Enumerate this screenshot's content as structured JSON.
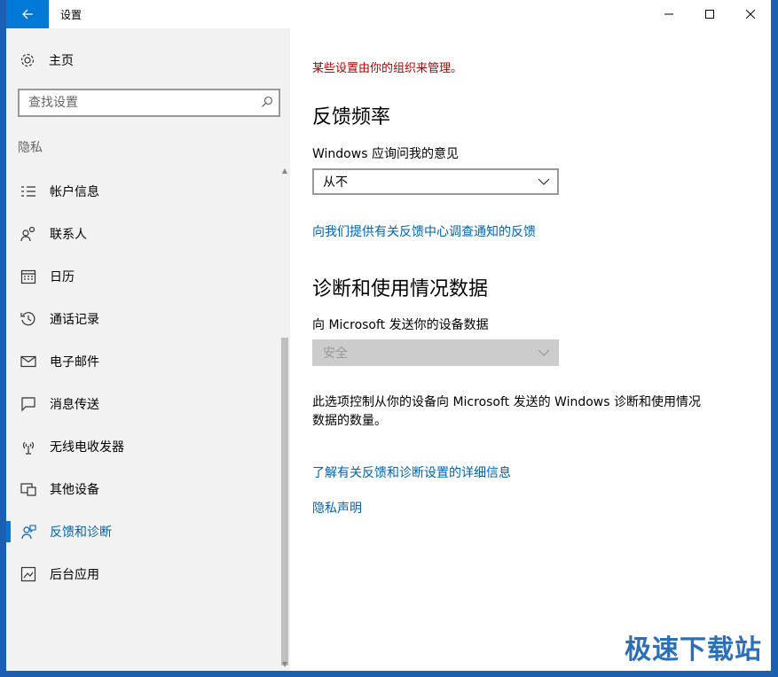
{
  "window": {
    "title": "设置"
  },
  "left": {
    "home": "主页",
    "search_placeholder": "查找设置",
    "section": "隐私",
    "items": [
      {
        "label": "帐户信息",
        "icon": "account-info-icon"
      },
      {
        "label": "联系人",
        "icon": "contacts-icon"
      },
      {
        "label": "日历",
        "icon": "calendar-icon"
      },
      {
        "label": "通话记录",
        "icon": "call-history-icon"
      },
      {
        "label": "电子邮件",
        "icon": "email-icon"
      },
      {
        "label": "消息传送",
        "icon": "messaging-icon"
      },
      {
        "label": "无线电收发器",
        "icon": "radios-icon"
      },
      {
        "label": "其他设备",
        "icon": "other-devices-icon"
      },
      {
        "label": "反馈和诊断",
        "icon": "feedback-icon",
        "active": true
      },
      {
        "label": "后台应用",
        "icon": "background-apps-icon"
      }
    ]
  },
  "right": {
    "managed_notice": "某些设置由你的组织来管理。",
    "feedback_heading": "反馈频率",
    "feedback_label": "Windows 应询问我的意见",
    "feedback_value": "从不",
    "feedback_link": "向我们提供有关反馈中心调查通知的反馈",
    "diag_heading": "诊断和使用情况数据",
    "diag_label": "向 Microsoft 发送你的设备数据",
    "diag_value": "安全",
    "diag_desc": "此选项控制从你的设备向 Microsoft 发送的 Windows 诊断和使用情况数据的数量。",
    "learn_link": "了解有关反馈和诊断设置的详细信息",
    "privacy_link": "隐私声明"
  },
  "watermark": "极速下载站",
  "colors": {
    "accent": "#0078d7",
    "link": "#0063b1",
    "warning": "#b30000"
  }
}
